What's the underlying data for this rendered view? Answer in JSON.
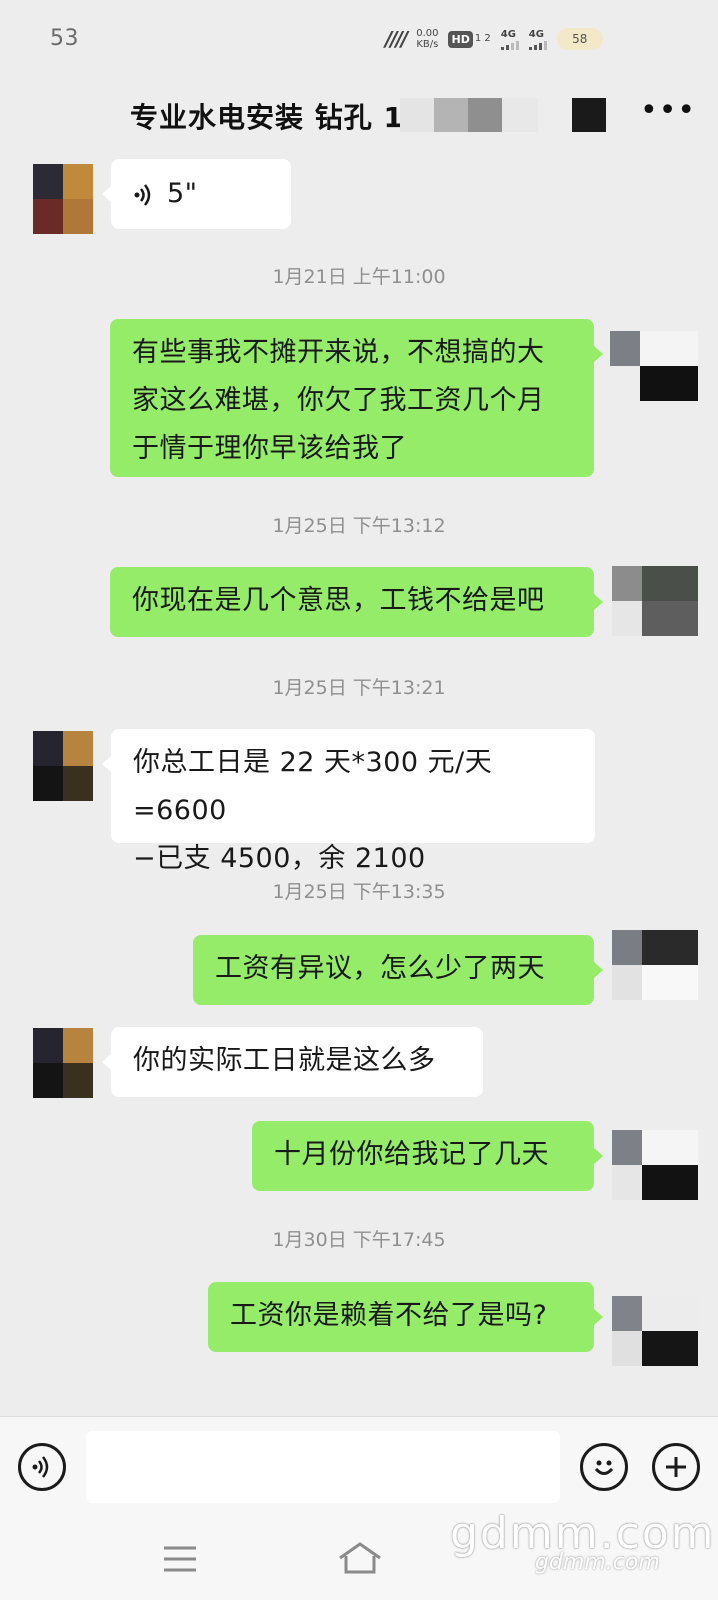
{
  "status_bar": {
    "time": "53",
    "net_speed_value": "0.00",
    "net_speed_unit": "KB/s",
    "hd_label": "HD",
    "hd_sub": "1 2",
    "signal1": "4G",
    "signal2": "4G",
    "battery": "58"
  },
  "header": {
    "title": "专业水电安装 钻孔 1",
    "more_label": "•••"
  },
  "messages": [
    {
      "id": "m1",
      "direction": "in",
      "type": "voice",
      "text": "5\""
    },
    {
      "id": "t1",
      "type": "timestamp",
      "text": "1月21日 上午11:00"
    },
    {
      "id": "m2",
      "direction": "out",
      "type": "text",
      "lines": [
        "有些事我不摊开来说，不想搞的大",
        "家这么难堪，你欠了我工资几个月",
        "于情于理你早该给我了"
      ]
    },
    {
      "id": "t2",
      "type": "timestamp",
      "text": "1月25日 下午13:12"
    },
    {
      "id": "m3",
      "direction": "out",
      "type": "text",
      "lines": [
        "你现在是几个意思，工钱不给是吧"
      ]
    },
    {
      "id": "t3",
      "type": "timestamp",
      "text": "1月25日 下午13:21"
    },
    {
      "id": "m4",
      "direction": "in",
      "type": "text",
      "lines": [
        "你总工日是 22 天*300 元/天=6600",
        "−已支 4500，余 2100"
      ]
    },
    {
      "id": "t4",
      "type": "timestamp",
      "text": "1月25日 下午13:35"
    },
    {
      "id": "m5",
      "direction": "out",
      "type": "text",
      "lines": [
        "工资有异议，怎么少了两天"
      ]
    },
    {
      "id": "m6",
      "direction": "in",
      "type": "text",
      "lines": [
        "你的实际工日就是这么多"
      ]
    },
    {
      "id": "m7",
      "direction": "out",
      "type": "text",
      "lines": [
        "十月份你给我记了几天"
      ]
    },
    {
      "id": "t5",
      "type": "timestamp",
      "text": "1月30日 下午17:45"
    },
    {
      "id": "m8",
      "direction": "out",
      "type": "text",
      "lines": [
        "工资你是赖着不给了是吗?"
      ]
    }
  ],
  "input_bar": {
    "placeholder": ""
  },
  "watermark": {
    "text": "gdmm.com",
    "small": "gdmm.com"
  },
  "colors": {
    "background": "#ededed",
    "out_bubble": "#95ec69",
    "in_bubble": "#ffffff",
    "timestamp": "#8f8f8f"
  }
}
